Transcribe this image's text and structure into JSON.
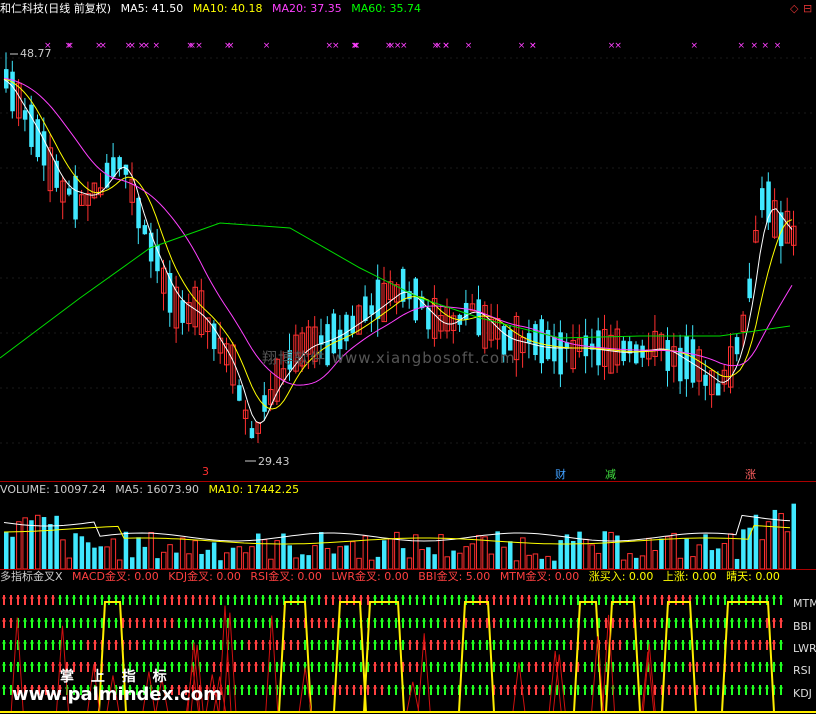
{
  "header": {
    "stock": "和仁科技(日线 前复权)",
    "ma": [
      {
        "label": "MA5: 41.50",
        "color": "#ffffff"
      },
      {
        "label": "MA10: 40.18",
        "color": "#ffff00"
      },
      {
        "label": "MA20: 37.35",
        "color": "#ff40ff"
      },
      {
        "label": "MA60: 35.74",
        "color": "#00ff00"
      }
    ],
    "corner_icons": [
      "◇",
      "⊟"
    ]
  },
  "price_chart": {
    "high_label": "48.77",
    "low_label": "29.43",
    "watermark": "翔博软件 www.xiangbosoft.com",
    "event_markers": [
      {
        "text": "3",
        "color": "#ff3030"
      },
      {
        "text": "财",
        "color": "#40a0ff"
      },
      {
        "text": "减",
        "color": "#40e040"
      },
      {
        "text": "涨",
        "color": "#ff6060"
      }
    ]
  },
  "volume": {
    "items": [
      {
        "label": "VOLUME: 10097.24",
        "color": "#cccccc"
      },
      {
        "label": "MA5: 16073.90",
        "color": "#cccccc"
      },
      {
        "label": "MA10: 17442.25",
        "color": "#ffff00"
      }
    ]
  },
  "indicator": {
    "items": [
      {
        "label": "多指标金叉X",
        "color": "#cccccc"
      },
      {
        "label": "MACD金叉: 0.00",
        "color": "#ff4040"
      },
      {
        "label": "KDJ金叉: 0.00",
        "color": "#ff4040"
      },
      {
        "label": "RSI金叉: 0.00",
        "color": "#ff4040"
      },
      {
        "label": "LWR金叉: 0.00",
        "color": "#ff4040"
      },
      {
        "label": "BBI金叉: 5.00",
        "color": "#ff4040"
      },
      {
        "label": "MTM金叉: 0.00",
        "color": "#ff4040"
      },
      {
        "label": "涨买入: 0.00",
        "color": "#ffff00"
      },
      {
        "label": "上涨: 0.00",
        "color": "#ffff00"
      },
      {
        "label": "晴天: 0.00",
        "color": "#ffff00"
      }
    ],
    "rows": [
      "MTM",
      "BBI",
      "LWR",
      "RSI",
      "KDJ"
    ],
    "watermark_cn": "掌 上 指 标",
    "watermark_url": "www.palmindex.com"
  }
}
